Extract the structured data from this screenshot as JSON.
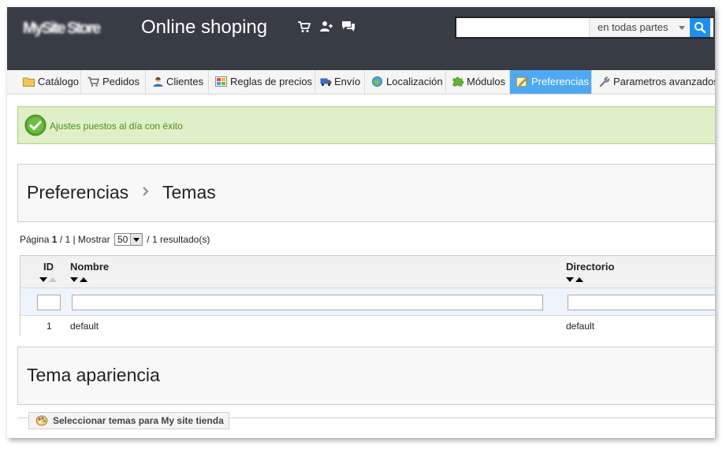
{
  "header": {
    "logo_text": "MySite Store",
    "site_title": "Online shoping",
    "search": {
      "value": "",
      "scope": "en todas partes"
    }
  },
  "nav": {
    "items": [
      {
        "label": "Catálogo",
        "icon": "folder-icon"
      },
      {
        "label": "Pedidos",
        "icon": "cart-icon"
      },
      {
        "label": "Clientes",
        "icon": "user-icon"
      },
      {
        "label": "Reglas de precios",
        "icon": "price-rules-icon"
      },
      {
        "label": "Envío",
        "icon": "truck-icon"
      },
      {
        "label": "Localización",
        "icon": "globe-icon"
      },
      {
        "label": "Módulos",
        "icon": "puzzle-icon"
      },
      {
        "label": "Preferencias",
        "icon": "preferences-icon",
        "active": true
      },
      {
        "label": "Parametros avanzados",
        "icon": "wrench-icon"
      }
    ]
  },
  "alert": {
    "text": "Ajustes puestos al día con éxito"
  },
  "breadcrumb": {
    "parent": "Preferencias",
    "current": "Temas"
  },
  "pager": {
    "label_page": "Página",
    "current": "1",
    "separator": "/",
    "total": "1",
    "show_label": "| Mostrar",
    "per_page": "50",
    "results": "/ 1 resultado(s)"
  },
  "table": {
    "columns": [
      "ID",
      "Nombre",
      "Directorio"
    ],
    "rows": [
      {
        "id": "1",
        "name": "default",
        "directory": "default"
      }
    ]
  },
  "appearance": {
    "title": "Tema apariencia"
  },
  "select_themes": {
    "label": "Seleccionar temas para My site tienda"
  },
  "colors": {
    "header_bg": "#383c45",
    "active_tab": "#4ea9f2",
    "success_text": "#4f8a23",
    "search_button": "#1e8ef0"
  }
}
